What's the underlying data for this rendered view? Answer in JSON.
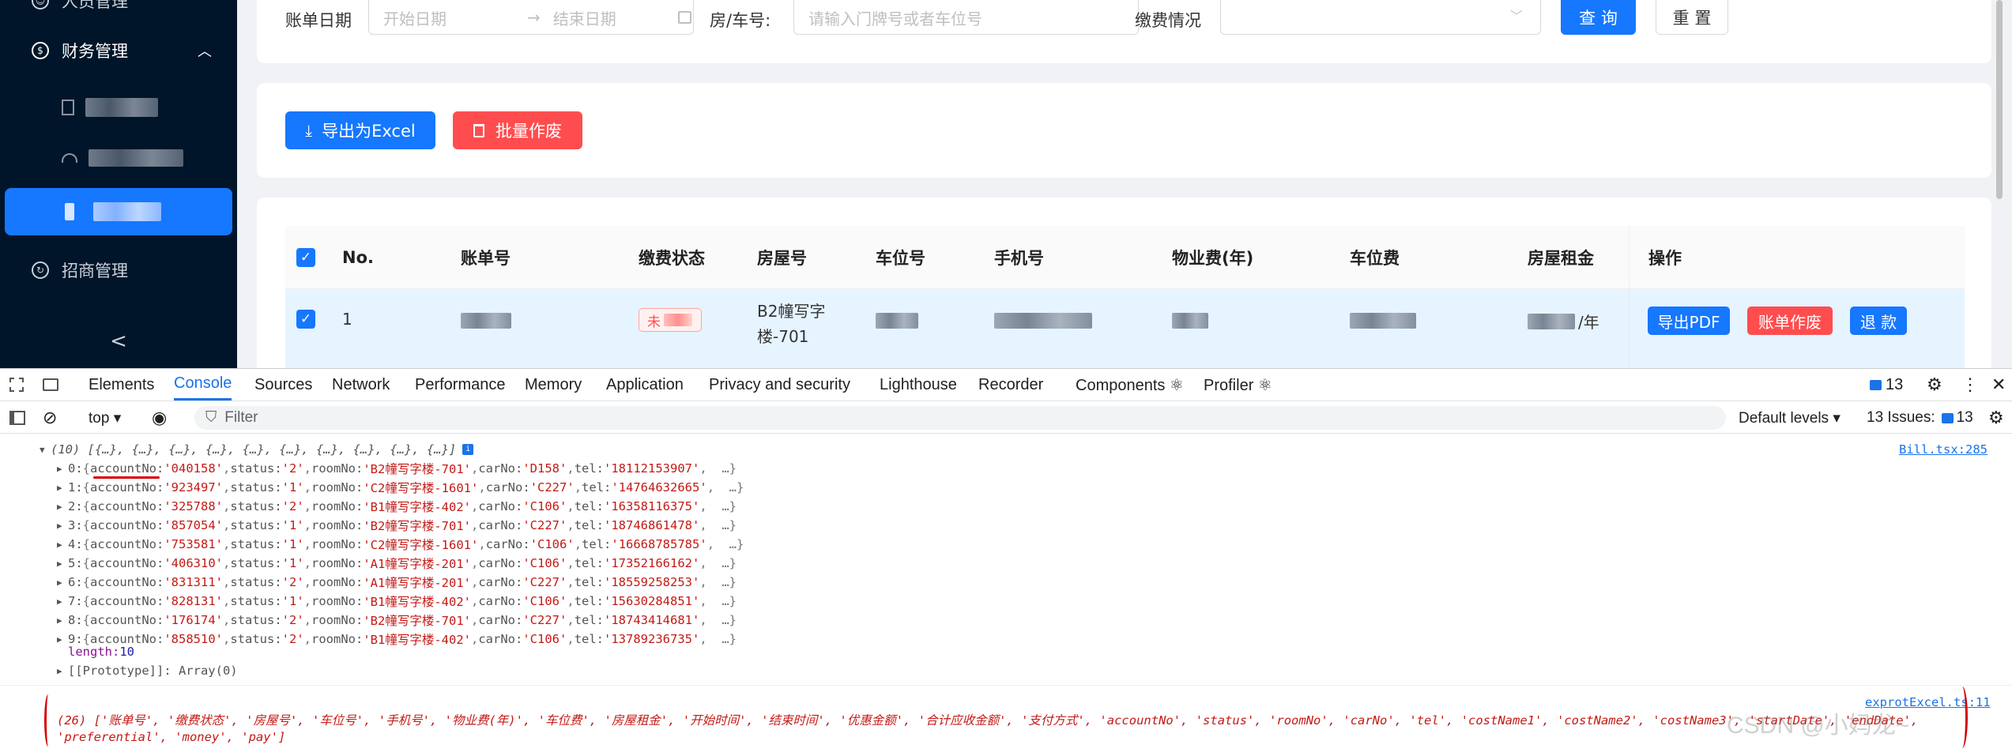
{
  "sidebar": {
    "items": [
      {
        "label": "人员管理"
      },
      {
        "label": "财务管理"
      },
      {
        "label": "招商管理"
      }
    ],
    "collapse_glyph": "<"
  },
  "search": {
    "date_label": "账单日期",
    "start_placeholder": "开始日期",
    "end_placeholder": "结束日期",
    "room_label": "房/车号:",
    "room_placeholder": "请输入门牌号或者车位号",
    "pay_label": "缴费情况",
    "query_label": "查 询",
    "reset_label": "重 置"
  },
  "actions": {
    "export_label": "导出为Excel",
    "void_label": "批量作废"
  },
  "table": {
    "headers": [
      "No.",
      "账单号",
      "缴费状态",
      "房屋号",
      "车位号",
      "手机号",
      "物业费(年)",
      "车位费",
      "房屋租金",
      "操作"
    ],
    "row": {
      "no": "1",
      "status": "未",
      "room_line1": "B2幢写字",
      "room_line2": "楼-701",
      "rent_suffix": "/年",
      "btn_pdf": "导出PDF",
      "btn_void": "账单作废",
      "btn_refund": "退 款"
    }
  },
  "devtools": {
    "tabs": [
      "Elements",
      "Console",
      "Sources",
      "Network",
      "Performance",
      "Memory",
      "Application",
      "Privacy and security",
      "Lighthouse",
      "Recorder",
      "Components ⚛",
      "Profiler ⚛"
    ],
    "active_tab": "Console",
    "issues_count": "13",
    "toolbar": {
      "context": "top ▾",
      "filter_placeholder": "Filter",
      "levels": "Default levels ▾",
      "issues": "13 Issues:",
      "issues_badge": "13"
    }
  },
  "console": {
    "group1_header": "(10) [{…}, {…}, {…}, {…}, {…}, {…}, {…}, {…}, {…}, {…}]",
    "group1_source": "Bill.tsx:285",
    "rows": [
      {
        "idx": "0",
        "accountNo": "'040158'",
        "status": "'2'",
        "roomNo": "'B2幢写字楼-701'",
        "carNo": "'D158'",
        "tel": "'18112153907'"
      },
      {
        "idx": "1",
        "accountNo": "'923497'",
        "status": "'1'",
        "roomNo": "'C2幢写字楼-1601'",
        "carNo": "'C227'",
        "tel": "'14764632665'"
      },
      {
        "idx": "2",
        "accountNo": "'325788'",
        "status": "'2'",
        "roomNo": "'B1幢写字楼-402'",
        "carNo": "'C106'",
        "tel": "'16358116375'"
      },
      {
        "idx": "3",
        "accountNo": "'857054'",
        "status": "'1'",
        "roomNo": "'B2幢写字楼-701'",
        "carNo": "'C227'",
        "tel": "'18746861478'"
      },
      {
        "idx": "4",
        "accountNo": "'753581'",
        "status": "'1'",
        "roomNo": "'C2幢写字楼-1601'",
        "carNo": "'C106'",
        "tel": "'16668785785'"
      },
      {
        "idx": "5",
        "accountNo": "'406310'",
        "status": "'1'",
        "roomNo": "'A1幢写字楼-201'",
        "carNo": "'C106'",
        "tel": "'17352166162'"
      },
      {
        "idx": "6",
        "accountNo": "'831311'",
        "status": "'2'",
        "roomNo": "'A1幢写字楼-201'",
        "carNo": "'C227'",
        "tel": "'18559258253'"
      },
      {
        "idx": "7",
        "accountNo": "'828131'",
        "status": "'1'",
        "roomNo": "'B1幢写字楼-402'",
        "carNo": "'C106'",
        "tel": "'15630284851'"
      },
      {
        "idx": "8",
        "accountNo": "'176174'",
        "status": "'2'",
        "roomNo": "'B2幢写字楼-701'",
        "carNo": "'C227'",
        "tel": "'18743414681'"
      },
      {
        "idx": "9",
        "accountNo": "'858510'",
        "status": "'2'",
        "roomNo": "'B1幢写字楼-402'",
        "carNo": "'C106'",
        "tel": "'13789236735'"
      }
    ],
    "length_line": "length: ",
    "length_value": "10",
    "prototype_line": "[[Prototype]]: Array(0)",
    "group2_source": "exprotExcel.ts:11",
    "group2_line1": "(26) ['账单号', '缴费状态', '房屋号', '车位号', '手机号', '物业费(年)', '车位费', '房屋租金', '开始时间', '结束时间', '优惠金额', '合计应收金额', '支付方式', 'accountNo', 'status', 'roomNo', 'carNo', 'tel', 'costName1', 'costName2', 'costName3', 'startDate', 'endDate',",
    "group2_line2": "'preferential', 'money', 'pay']",
    "watermark": "CSDN @小妈龙~"
  },
  "colors": {
    "primary": "#1677ff",
    "danger": "#ff4d4f",
    "sidebar_bg": "#001529",
    "console_string": "#c41a16",
    "console_number": "#1a1aa6"
  }
}
